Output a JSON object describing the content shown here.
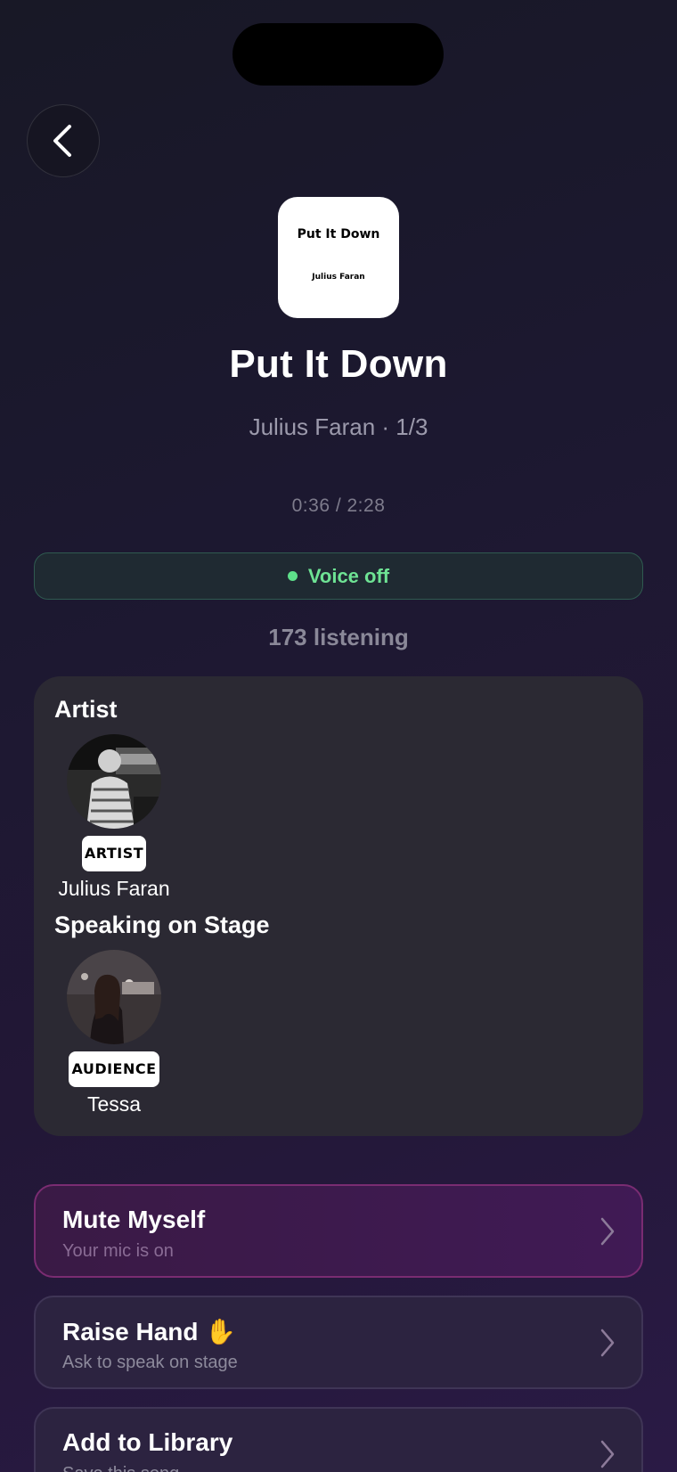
{
  "cover": {
    "title": "Put It Down",
    "artist": "Julius Faran"
  },
  "song": {
    "title": "Put It Down",
    "subtitle": "Julius Faran · 1/3",
    "time": "0:36 / 2:28"
  },
  "voice": {
    "label": "Voice off",
    "dot_color": "#5ee08a"
  },
  "listeners": "173 listening",
  "stage": {
    "artist_section": "Artist",
    "artist": {
      "badge": "ARTIST",
      "name": "Julius Faran"
    },
    "speakers_section": "Speaking on Stage",
    "speaker": {
      "badge": "AUDIENCE",
      "name": "Tessa"
    }
  },
  "actions": [
    {
      "title": "Mute Myself",
      "subtitle": "Your mic is on"
    },
    {
      "title": "Raise Hand",
      "emoji": "✋",
      "subtitle": "Ask to speak on stage"
    },
    {
      "title": "Add to Library",
      "subtitle": "Save this song"
    }
  ],
  "colors": {
    "accent_green": "#6ee394",
    "mute_border": "#7a2c72"
  }
}
